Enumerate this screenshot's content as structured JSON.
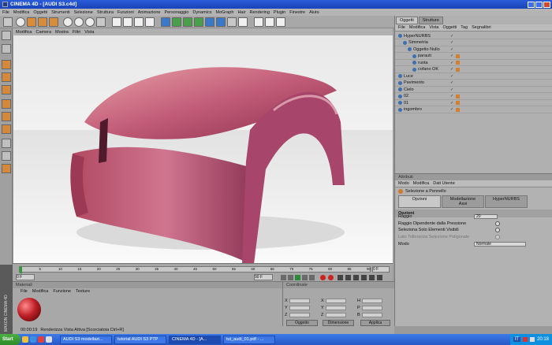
{
  "window": {
    "title": "CINEMA 4D - [AUDI S3.c4d]"
  },
  "menubar": [
    "File",
    "Modifica",
    "Oggetti",
    "Strumenti",
    "Selezione",
    "Struttura",
    "Funzioni",
    "Animazione",
    "Personaggio",
    "Dynamics",
    "MoGraph",
    "Hair",
    "Rendering",
    "Plugin",
    "Finestre",
    "Aiuto"
  ],
  "viewport": {
    "menu": [
      "Modifica",
      "Camera",
      "Mostra",
      "Filtri",
      "Vista"
    ]
  },
  "timeline": {
    "ticks": [
      "0",
      "5",
      "10",
      "15",
      "20",
      "25",
      "30",
      "35",
      "40",
      "45",
      "50",
      "55",
      "60",
      "65",
      "70",
      "75",
      "80",
      "85",
      "90"
    ],
    "end_frame": "0 F",
    "start_field": "0 F",
    "end_field": "90 F",
    "current_field": "0 F"
  },
  "material": {
    "header": "Materiali",
    "menu": [
      "File",
      "Modifica",
      "Funzione",
      "Texture"
    ],
    "swatch_color": "#c02028"
  },
  "coords": {
    "header": "Coordinate",
    "row_labels": [
      "X",
      "Y",
      "Z"
    ],
    "col2_labels": [
      "X",
      "Y",
      "Z"
    ],
    "col3_labels": [
      "H",
      "P",
      "B"
    ],
    "mode_select": "Oggetto",
    "size_select": "Dimensione",
    "apply_button": "Applica"
  },
  "objects": {
    "tabs": [
      "Oggetti",
      "Strutture"
    ],
    "menu": [
      "File",
      "Modifica",
      "Vista",
      "Oggetti",
      "Tag",
      "Segnalibri"
    ],
    "rows": [
      {
        "name": "HyperNURBS",
        "indent": 0
      },
      {
        "name": "Simmetria",
        "indent": 1
      },
      {
        "name": "Oggetto Nullo",
        "indent": 2
      },
      {
        "name": "parauti",
        "indent": 3
      },
      {
        "name": "ruota",
        "indent": 3
      },
      {
        "name": "cofano OK",
        "indent": 3
      },
      {
        "name": "Luce",
        "indent": 0
      },
      {
        "name": "Pavimento",
        "indent": 0
      },
      {
        "name": "Cielo",
        "indent": 0
      },
      {
        "name": "02",
        "indent": 0
      },
      {
        "name": "01",
        "indent": 0
      },
      {
        "name": "ingombro",
        "indent": 0
      }
    ]
  },
  "attributes": {
    "header": "Attributi",
    "menu": [
      "Modo",
      "Modifica",
      "Dati Utente"
    ],
    "tool_name": "Selezione a Pennello",
    "tabs": [
      "Opzioni",
      "Modellazione Assi",
      "HyperNURBS"
    ],
    "section": "Opzioni",
    "raggio_label": "Raggio",
    "raggio_value": "20",
    "opt1": "Raggio Dipendente dalla Pressione",
    "opt2": "Seleziona Solo Elementi Visibili",
    "opt3": "Lato Tolleranza Selezione Poligonale",
    "modo_label": "Modo",
    "modo_value": "Normale"
  },
  "status": {
    "time": "00:00:19",
    "text": "Renderizza Vista Attiva [Scorciatoia Ctrl+R]"
  },
  "maxon_label": "MAXON CINEMA 4D",
  "taskbar": {
    "start": "Start",
    "tasks": [
      "AUDI S3 modellazi...",
      "tutorial AUDI S3 PTP",
      "CINEMA 4D - [A...",
      "tut_audi_01.pdf - ..."
    ],
    "lang": "IT",
    "clock": "20:18"
  }
}
